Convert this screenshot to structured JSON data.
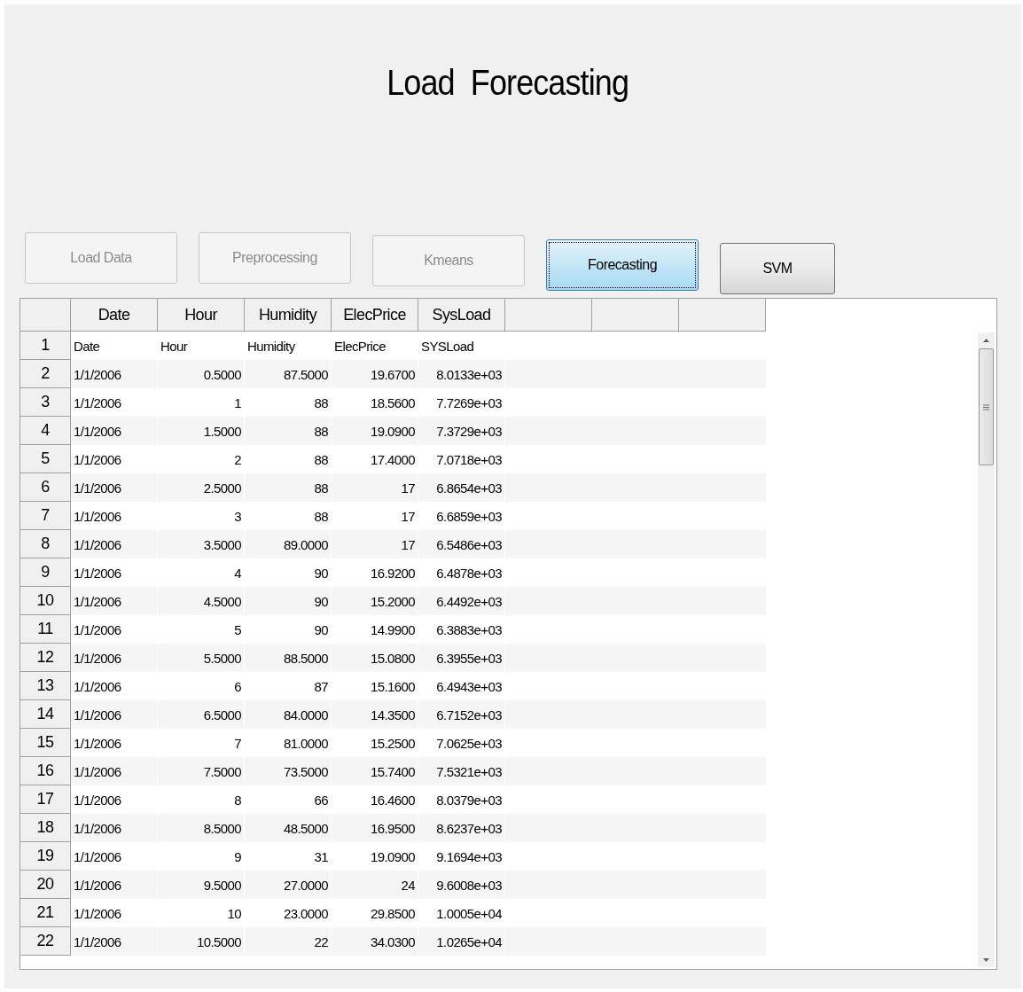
{
  "title": "Load  Forecasting",
  "buttons": [
    {
      "label": "Load Data",
      "disabled": true,
      "selected": false
    },
    {
      "label": "Preprocessing",
      "disabled": true,
      "selected": false
    },
    {
      "label": "Kmeans",
      "disabled": true,
      "selected": false
    },
    {
      "label": "Forecasting",
      "disabled": false,
      "selected": true
    },
    {
      "label": "SVM",
      "disabled": false,
      "selected": false
    }
  ],
  "table": {
    "columns": [
      "Date",
      "Hour",
      "Humidity",
      "ElecPrice",
      "SysLoad"
    ],
    "rows": [
      {
        "number": "1",
        "kind": "text",
        "cells": [
          "Date",
          "Hour",
          "Humidity",
          "ElecPrice",
          "SYSLoad"
        ]
      },
      {
        "number": "2",
        "kind": "numeric",
        "cells": [
          "1/1/2006",
          "0.5000",
          "87.5000",
          "19.6700",
          "8.0133e+03"
        ]
      },
      {
        "number": "3",
        "kind": "numeric",
        "cells": [
          "1/1/2006",
          "1",
          "88",
          "18.5600",
          "7.7269e+03"
        ]
      },
      {
        "number": "4",
        "kind": "numeric",
        "cells": [
          "1/1/2006",
          "1.5000",
          "88",
          "19.0900",
          "7.3729e+03"
        ]
      },
      {
        "number": "5",
        "kind": "numeric",
        "cells": [
          "1/1/2006",
          "2",
          "88",
          "17.4000",
          "7.0718e+03"
        ]
      },
      {
        "number": "6",
        "kind": "numeric",
        "cells": [
          "1/1/2006",
          "2.5000",
          "88",
          "17",
          "6.8654e+03"
        ]
      },
      {
        "number": "7",
        "kind": "numeric",
        "cells": [
          "1/1/2006",
          "3",
          "88",
          "17",
          "6.6859e+03"
        ]
      },
      {
        "number": "8",
        "kind": "numeric",
        "cells": [
          "1/1/2006",
          "3.5000",
          "89.0000",
          "17",
          "6.5486e+03"
        ]
      },
      {
        "number": "9",
        "kind": "numeric",
        "cells": [
          "1/1/2006",
          "4",
          "90",
          "16.9200",
          "6.4878e+03"
        ]
      },
      {
        "number": "10",
        "kind": "numeric",
        "cells": [
          "1/1/2006",
          "4.5000",
          "90",
          "15.2000",
          "6.4492e+03"
        ]
      },
      {
        "number": "11",
        "kind": "numeric",
        "cells": [
          "1/1/2006",
          "5",
          "90",
          "14.9900",
          "6.3883e+03"
        ]
      },
      {
        "number": "12",
        "kind": "numeric",
        "cells": [
          "1/1/2006",
          "5.5000",
          "88.5000",
          "15.0800",
          "6.3955e+03"
        ]
      },
      {
        "number": "13",
        "kind": "numeric",
        "cells": [
          "1/1/2006",
          "6",
          "87",
          "15.1600",
          "6.4943e+03"
        ]
      },
      {
        "number": "14",
        "kind": "numeric",
        "cells": [
          "1/1/2006",
          "6.5000",
          "84.0000",
          "14.3500",
          "6.7152e+03"
        ]
      },
      {
        "number": "15",
        "kind": "numeric",
        "cells": [
          "1/1/2006",
          "7",
          "81.0000",
          "15.2500",
          "7.0625e+03"
        ]
      },
      {
        "number": "16",
        "kind": "numeric",
        "cells": [
          "1/1/2006",
          "7.5000",
          "73.5000",
          "15.7400",
          "7.5321e+03"
        ]
      },
      {
        "number": "17",
        "kind": "numeric",
        "cells": [
          "1/1/2006",
          "8",
          "66",
          "16.4600",
          "8.0379e+03"
        ]
      },
      {
        "number": "18",
        "kind": "numeric",
        "cells": [
          "1/1/2006",
          "8.5000",
          "48.5000",
          "16.9500",
          "8.6237e+03"
        ]
      },
      {
        "number": "19",
        "kind": "numeric",
        "cells": [
          "1/1/2006",
          "9",
          "31",
          "19.0900",
          "9.1694e+03"
        ]
      },
      {
        "number": "20",
        "kind": "numeric",
        "cells": [
          "1/1/2006",
          "9.5000",
          "27.0000",
          "24",
          "9.6008e+03"
        ]
      },
      {
        "number": "21",
        "kind": "numeric",
        "cells": [
          "1/1/2006",
          "10",
          "23.0000",
          "29.8500",
          "1.0005e+04"
        ]
      },
      {
        "number": "22",
        "kind": "numeric",
        "cells": [
          "1/1/2006",
          "10.5000",
          "22",
          "34.0300",
          "1.0265e+04"
        ]
      }
    ]
  }
}
